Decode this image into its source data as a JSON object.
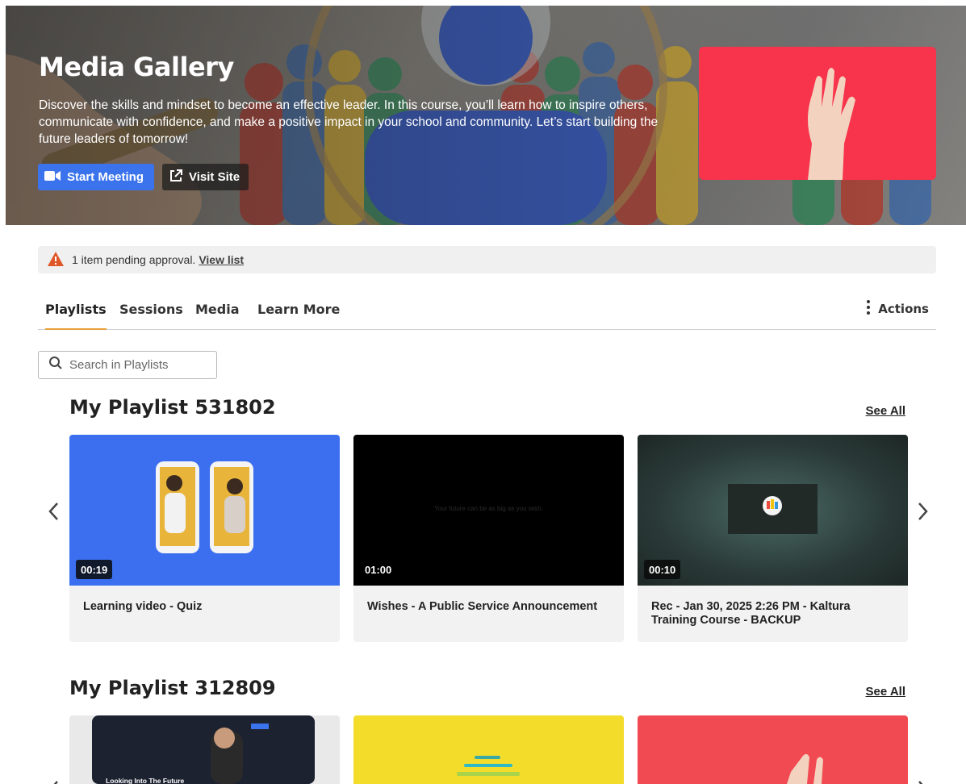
{
  "hero": {
    "title": "Media Gallery",
    "description": "Discover the skills and mindset to become an effective leader. In this course, you’ll learn how to inspire others, communicate with confidence, and make a positive impact in your school and community. Let’s start building the future leaders of tomorrow!",
    "start_meeting_label": "Start Meeting",
    "visit_site_label": "Visit Site",
    "accent_color": "#3a73ec",
    "thumb_color": "#f7344b"
  },
  "alert": {
    "text": "1 item pending approval.",
    "link_label": "View list",
    "icon": "warning-icon",
    "icon_color": "#e0582a"
  },
  "tabs": [
    {
      "label": "Playlists",
      "active": true
    },
    {
      "label": "Sessions",
      "active": false
    },
    {
      "label": "Media",
      "active": false
    },
    {
      "label": "Learn More",
      "active": false
    }
  ],
  "actions_label": "Actions",
  "search": {
    "placeholder": "Search in Playlists"
  },
  "playlists": [
    {
      "title": "My Playlist 531802",
      "see_all_label": "See All",
      "cards": [
        {
          "duration": "00:19",
          "title": "Learning video - Quiz",
          "thumb_color": "#3b6ff0"
        },
        {
          "duration": "01:00",
          "title": "Wishes - A Public Service Announcement",
          "thumb_text": "Your future can be as big as you wish.",
          "thumb_color": "#000000"
        },
        {
          "duration": "00:10",
          "title": "Rec - Jan 30, 2025 2:26 PM - Kaltura Training Course - BACKUP",
          "thumb_color": "#2c3f3c"
        }
      ]
    },
    {
      "title": "My Playlist 312809",
      "see_all_label": "See All",
      "cards": [
        {
          "thumb_text": "Looking Into The Future",
          "thumb_color": "#1d2230"
        },
        {
          "thumb_color": "#f4dc2b"
        },
        {
          "thumb_color": "#f24a52"
        }
      ]
    }
  ]
}
